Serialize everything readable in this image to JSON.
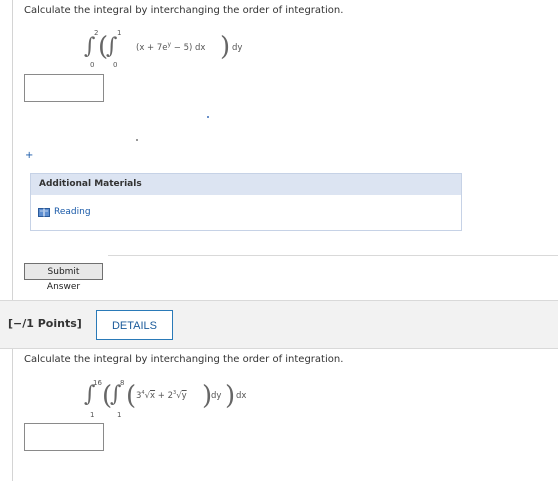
{
  "question1": {
    "prompt": "Calculate the integral by interchanging the order of integration.",
    "outer_upper": "2",
    "outer_lower": "0",
    "inner_upper": "1",
    "inner_lower": "0",
    "integrand_open": "(x + 7e",
    "integrand_exp": "y",
    "integrand_close": " − 5) dx",
    "outer_diff": "dy",
    "answer_value": ""
  },
  "additional_materials": {
    "title": "Additional Materials",
    "reading_label": "Reading"
  },
  "submit_label": "Submit Answer",
  "question2": {
    "points_label": "[−/1 Points]",
    "details_label": "DETAILS",
    "prompt": "Calculate the integral by interchanging the order of integration.",
    "outer_upper": "16",
    "outer_lower": "1",
    "inner_upper": "8",
    "inner_lower": "1",
    "term1_coef": "3",
    "term1_index": "4",
    "term1_radicand": "x",
    "plus": " + 2",
    "term2_index": "3",
    "term2_radicand": "y",
    "inner_diff": "dy",
    "outer_diff": "dx",
    "answer_value": ""
  },
  "icons": {
    "plus_marker": "+",
    "book": "book-icon"
  }
}
